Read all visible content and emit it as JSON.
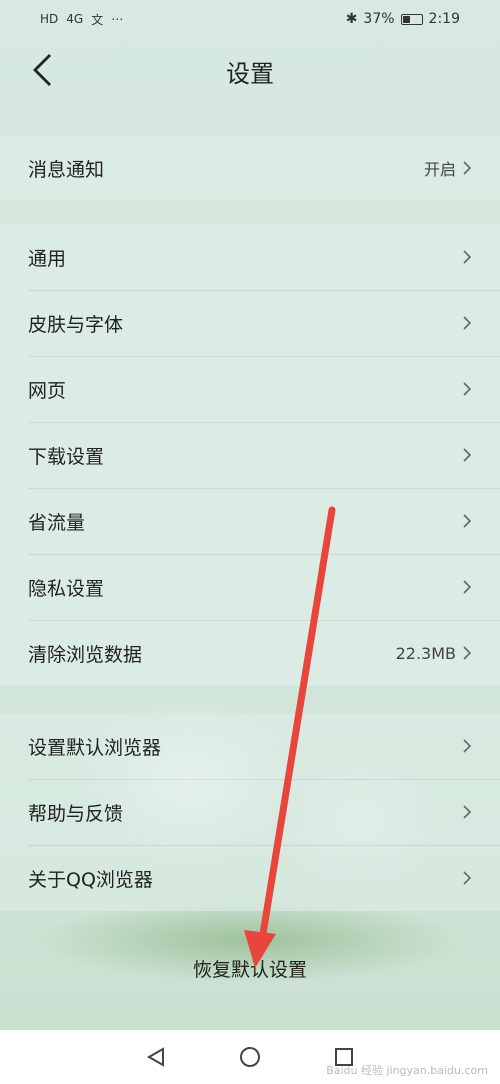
{
  "status": {
    "left": [
      "HD",
      "4G",
      "文",
      "⋯"
    ],
    "battery": "37%",
    "time": "2:19"
  },
  "header": {
    "title": "设置"
  },
  "groups": [
    [
      {
        "label": "消息通知",
        "value": "开启"
      }
    ],
    [
      {
        "label": "通用",
        "value": ""
      },
      {
        "label": "皮肤与字体",
        "value": ""
      },
      {
        "label": "网页",
        "value": ""
      },
      {
        "label": "下载设置",
        "value": ""
      },
      {
        "label": "省流量",
        "value": ""
      },
      {
        "label": "隐私设置",
        "value": ""
      },
      {
        "label": "清除浏览数据",
        "value": "22.3MB"
      }
    ],
    [
      {
        "label": "设置默认浏览器",
        "value": ""
      },
      {
        "label": "帮助与反馈",
        "value": ""
      },
      {
        "label": "关于QQ浏览器",
        "value": ""
      }
    ]
  ],
  "reset": {
    "label": "恢复默认设置"
  },
  "watermark": "Baidu 经验 jingyan.baidu.com",
  "colors": {
    "annotation_arrow": "#e8453c"
  }
}
